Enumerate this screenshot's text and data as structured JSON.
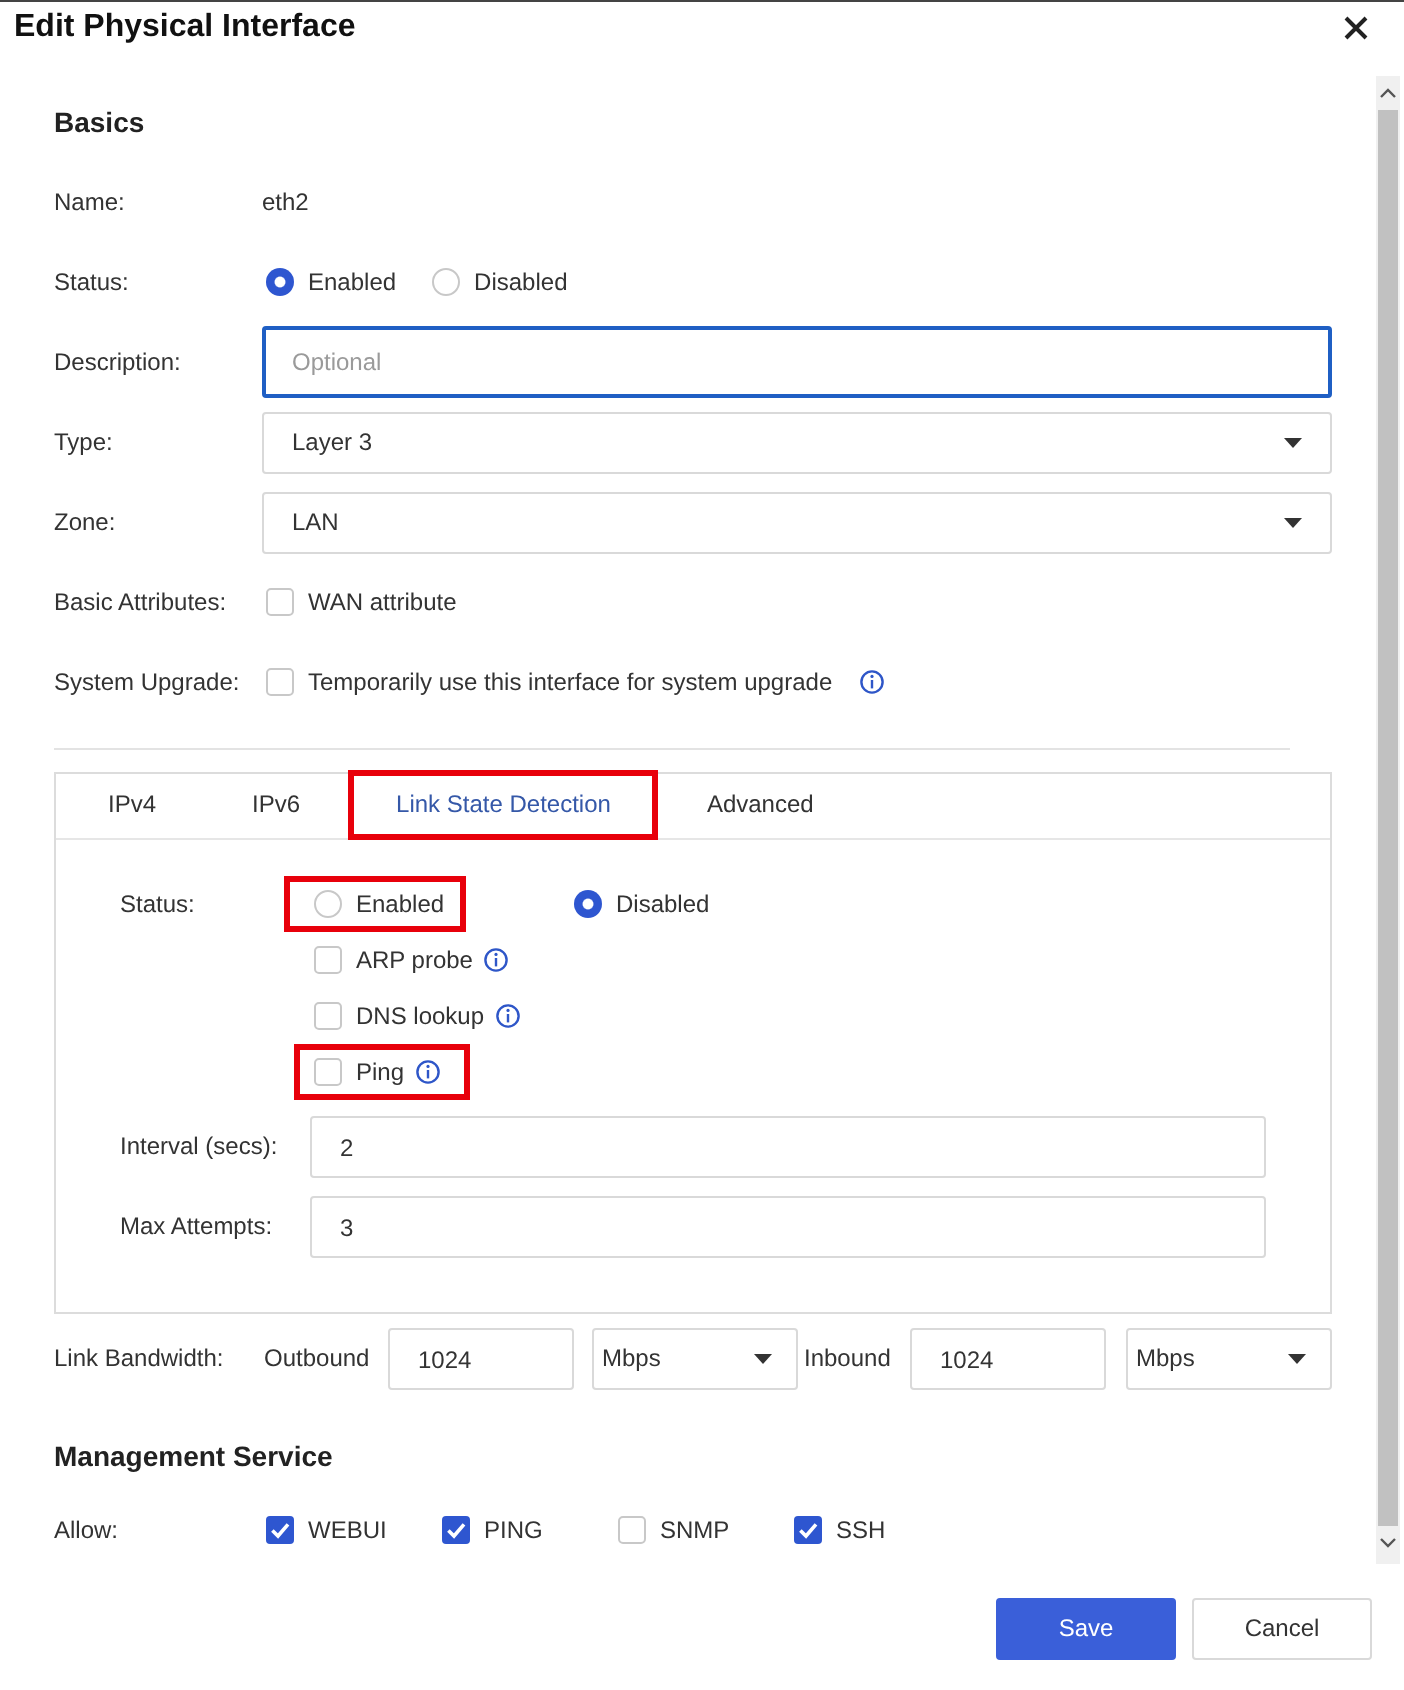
{
  "dialog": {
    "title": "Edit Physical Interface"
  },
  "basics": {
    "heading": "Basics",
    "name": {
      "label": "Name:",
      "value": "eth2"
    },
    "status": {
      "label": "Status:",
      "options": [
        {
          "label": "Enabled",
          "selected": true
        },
        {
          "label": "Disabled",
          "selected": false
        }
      ]
    },
    "description": {
      "label": "Description:",
      "placeholder": "Optional",
      "focused": true
    },
    "type": {
      "label": "Type:",
      "value": "Layer 3"
    },
    "zone": {
      "label": "Zone:",
      "value": "LAN"
    },
    "basic_attributes": {
      "label": "Basic Attributes:",
      "option": {
        "label": "WAN attribute",
        "checked": false
      }
    },
    "system_upgrade": {
      "label": "System Upgrade:",
      "option": {
        "label": "Temporarily use this interface for system upgrade",
        "checked": false,
        "has_info": true
      }
    }
  },
  "tabs": [
    {
      "label": "IPv4",
      "selected": false,
      "highlighted": false
    },
    {
      "label": "IPv6",
      "selected": false,
      "highlighted": false
    },
    {
      "label": "Link State Detection",
      "selected": true,
      "highlighted": true
    },
    {
      "label": "Advanced",
      "selected": false,
      "highlighted": false
    }
  ],
  "link_state_detection": {
    "status": {
      "label": "Status:",
      "options": [
        {
          "label": "Enabled",
          "selected": false,
          "highlighted": true
        },
        {
          "label": "Disabled",
          "selected": true,
          "highlighted": false
        }
      ]
    },
    "probes": [
      {
        "label": "ARP probe",
        "checked": false,
        "has_info": true,
        "highlighted": false
      },
      {
        "label": "DNS lookup",
        "checked": false,
        "has_info": true,
        "highlighted": false
      },
      {
        "label": "Ping",
        "checked": false,
        "has_info": true,
        "highlighted": true
      }
    ],
    "interval": {
      "label": "Interval (secs):",
      "value": "2"
    },
    "max_attempts": {
      "label": "Max Attempts:",
      "value": "3"
    }
  },
  "link_bandwidth": {
    "label": "Link Bandwidth:",
    "directions": [
      {
        "label": "Outbound",
        "value": "1024",
        "unit": "Mbps"
      },
      {
        "label": "Inbound",
        "value": "1024",
        "unit": "Mbps"
      }
    ]
  },
  "management_service": {
    "heading": "Management Service",
    "allow": {
      "label": "Allow:",
      "options": [
        {
          "label": "WEBUI",
          "checked": true
        },
        {
          "label": "PING",
          "checked": true
        },
        {
          "label": "SNMP",
          "checked": false
        },
        {
          "label": "SSH",
          "checked": true
        }
      ]
    }
  },
  "buttons": [
    {
      "label": "Save",
      "kind": "primary"
    },
    {
      "label": "Cancel",
      "kind": "secondary"
    }
  ]
}
